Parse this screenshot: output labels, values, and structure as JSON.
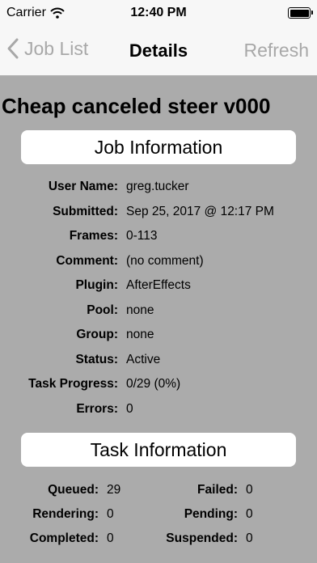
{
  "status_bar": {
    "carrier": "Carrier",
    "time": "12:40 PM"
  },
  "nav": {
    "back_label": "Job List",
    "title": "Details",
    "refresh_label": "Refresh"
  },
  "job": {
    "title": "Cheap canceled steer v000"
  },
  "job_info": {
    "header": "Job Information",
    "rows": [
      {
        "label": "User Name:",
        "value": "greg.tucker"
      },
      {
        "label": "Submitted:",
        "value": "Sep 25, 2017 @ 12:17 PM"
      },
      {
        "label": "Frames:",
        "value": "0-113"
      },
      {
        "label": "Comment:",
        "value": "(no comment)"
      },
      {
        "label": "Plugin:",
        "value": "AfterEffects"
      },
      {
        "label": "Pool:",
        "value": "none"
      },
      {
        "label": "Group:",
        "value": "none"
      },
      {
        "label": "Status:",
        "value": "Active"
      },
      {
        "label": "Task Progress:",
        "value": "0/29 (0%)"
      },
      {
        "label": "Errors:",
        "value": "0"
      }
    ]
  },
  "task_info": {
    "header": "Task Information",
    "rows": [
      {
        "left_label": "Queued:",
        "left_value": "29",
        "right_label": "Failed:",
        "right_value": "0"
      },
      {
        "left_label": "Rendering:",
        "left_value": "0",
        "right_label": "Pending:",
        "right_value": "0"
      },
      {
        "left_label": "Completed:",
        "left_value": "0",
        "right_label": "Suspended:",
        "right_value": "0"
      }
    ]
  }
}
